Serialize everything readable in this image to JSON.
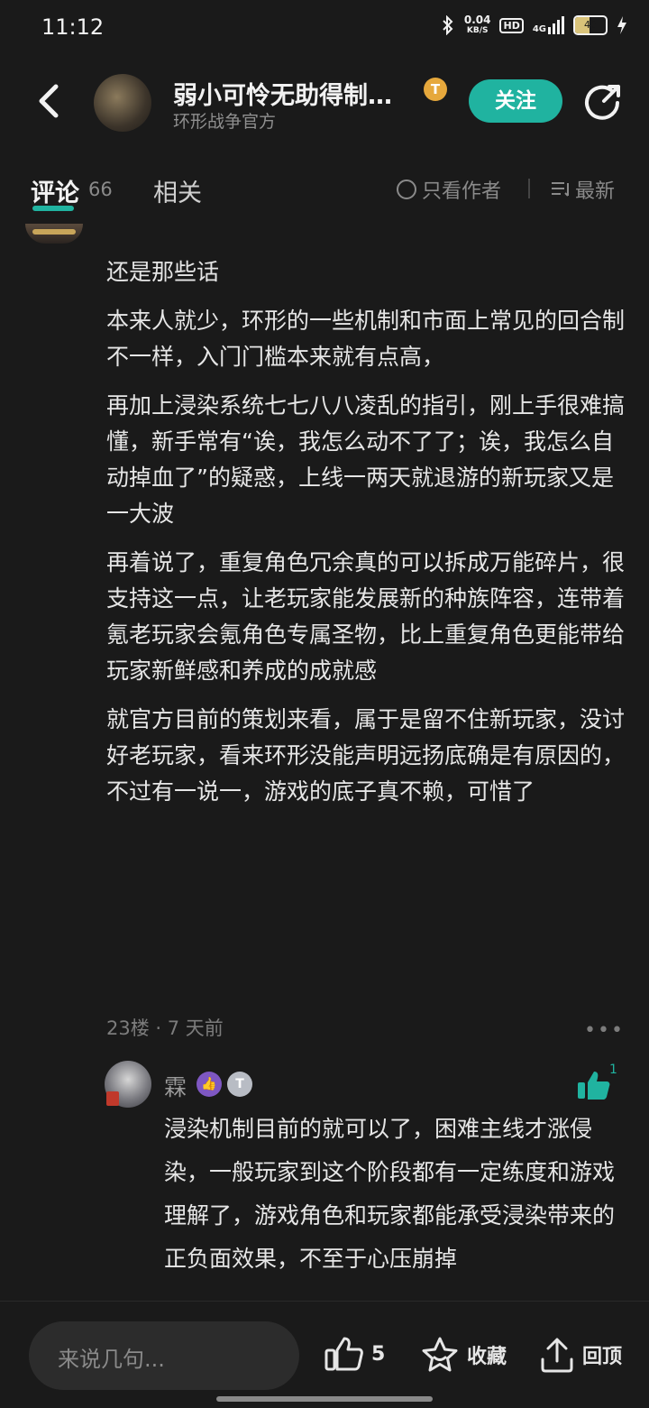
{
  "status": {
    "time": "11:12",
    "net_speed": "0.04",
    "net_unit": "KB/S",
    "hd": "HD",
    "signal": "4G",
    "battery": "46",
    "battery_level": 0.46
  },
  "header": {
    "title": "弱小可怜无助得制…",
    "subtitle": "环形战争官方",
    "badge": "T",
    "follow_label": "关注"
  },
  "tabs": {
    "comment_label": "评论",
    "comment_count": "66",
    "related_label": "相关",
    "only_author_label": "只看作者",
    "sort_label": "最新"
  },
  "comment": {
    "paragraphs": [
      "还是那些话",
      "本来人就少，环形的一些机制和市面上常见的回合制不一样，入门门槛本来就有点高，",
      "再加上浸染系统七七八八凌乱的指引，刚上手很难搞懂，新手常有“诶，我怎么动不了了；诶，我怎么自动掉血了”的疑惑，上线一两天就退游的新玩家又是一大波",
      "再着说了，重复角色冗余真的可以拆成万能碎片，很支持这一点，让老玩家能发展新的种族阵容，连带着氪老玩家会氪角色专属圣物，比上重复角色更能带给玩家新鲜感和养成的成就感",
      "就官方目前的策划来看，属于是留不住新玩家，没讨好老玩家，看来环形没能声明远扬底确是有原因的，不过有一说一，游戏的底子真不赖，可惜了"
    ],
    "meta": "23楼 · 7 天前",
    "more": "•••"
  },
  "reply": {
    "name": "霖",
    "level_badge": "👍",
    "t_badge": "T",
    "like_count": "1",
    "text": "浸染机制目前的就可以了，困难主线才涨侵染，一般玩家到这个阶段都有一定练度和游戏理解了，游戏角色和玩家都能承受浸染带来的正负面效果，不至于心压崩掉"
  },
  "bottom": {
    "input_placeholder": "来说几句...",
    "like_count": "5",
    "favorite_label": "收藏",
    "top_label": "回顶"
  },
  "colors": {
    "accent": "#20b3a0",
    "background": "#1a1a1a"
  },
  "icons": [
    "bluetooth-icon",
    "signal-icon",
    "battery-icon",
    "back-icon",
    "share-icon",
    "sort-icon",
    "thumbs-up-icon",
    "star-icon",
    "upload-icon"
  ]
}
